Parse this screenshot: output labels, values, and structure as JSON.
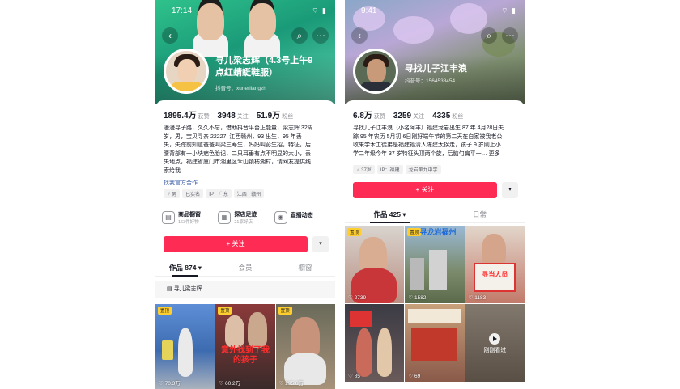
{
  "left": {
    "time": "17:14",
    "name_line1": "寻儿梁志辉（4.3号上午9",
    "name_line2": "点红蜻蜓鞋服）",
    "handle": "抖音号：xunerliangzh",
    "stats": [
      {
        "num": "1895.4万",
        "label": "获赞"
      },
      {
        "num": "3948",
        "label": "关注"
      },
      {
        "num": "51.9万",
        "label": "粉丝"
      }
    ],
    "bio": [
      "漫漫寻子路，久久不忘，借助抖音平台正能量，梁志辉 32周",
      "岁，男，宝贝寻亲 22227. 江西赣州，93 出生，95 年丢",
      "失，失踪前知道爸爸叫梁三寿生，妈妈叫彭生招，特征，后",
      "腰背部有一小块疤色胎记，二只耳垂有点不明显的大小，丢",
      "失地点，福建省厦门市湖里区禾山镇枋湖村，请网友提供线",
      "索给我"
    ],
    "link": "找我官方合作",
    "tags": [
      "♂ 男",
      "已实名",
      "IP：广东",
      "江西 · 赣州"
    ],
    "services": [
      {
        "icon": "▤",
        "title": "商品橱窗",
        "sub": "163件好物"
      },
      {
        "icon": "▦",
        "title": "探店足迹",
        "sub": "21家好店"
      },
      {
        "icon": "◉",
        "title": "直播动态",
        "sub": "…"
      }
    ],
    "follow_label": "+ 关注",
    "more_label": "▾",
    "tabs": [
      "作品 874 ▾",
      "会员",
      "橱窗"
    ],
    "collection": "寻儿梁志辉",
    "grid": [
      {
        "pin": "置顶",
        "likes": "♡ 70.3万",
        "caption": ""
      },
      {
        "pin": "置顶",
        "likes": "♡ 60.2万",
        "caption": "意外找到了我的孩子"
      },
      {
        "pin": "置顶",
        "likes": "♡ 295.8万",
        "caption": ""
      }
    ]
  },
  "right": {
    "time": "9:41",
    "name": "寻找儿子江丰浪",
    "handle": "抖音号：1564538454",
    "stats": [
      {
        "num": "6.8万",
        "label": "获赞"
      },
      {
        "num": "3259",
        "label": "关注"
      },
      {
        "num": "4335",
        "label": "粉丝"
      }
    ],
    "bio": [
      "寻找儿子江丰浪（小名阿丰）福建龙岩出生 87 年 4月28日失",
      "踪 95 年农历 5月初 6日刚好端午节的第二天在自家被我老公",
      "收来学木工徒弟是福建福清人陈建太拐走，孩子 9 岁刚上小",
      "学二年级今年 37 岁特征头顶两个旋，后脑勺扁平一… 更多"
    ],
    "tags": [
      "♂ 37岁",
      "IP：福建",
      "龙岩第九中学"
    ],
    "follow_label": "+ 关注",
    "more_label": "▾",
    "tabs": [
      "作品 425 ▾",
      "日常"
    ],
    "grid": [
      {
        "pin": "置顶",
        "likes": "♡ 2739",
        "caption": ""
      },
      {
        "pin": "置顶",
        "likes": "♡ 1582",
        "caption": "寻龙岩福州"
      },
      {
        "pin": "",
        "likes": "♡ 1183",
        "caption": "寻当人员"
      },
      {
        "pin": "",
        "likes": "♡ 85",
        "caption": ""
      },
      {
        "pin": "",
        "likes": "♡ 69",
        "caption": ""
      },
      {
        "pin": "",
        "likes": "",
        "caption": "刚刚看过"
      }
    ]
  }
}
